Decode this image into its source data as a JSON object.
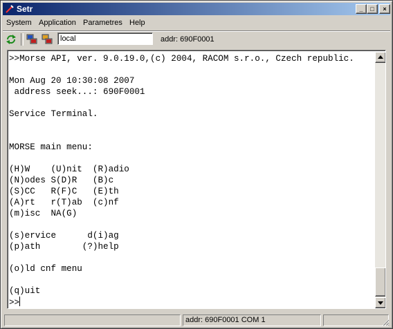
{
  "window": {
    "title": "Setr",
    "controls": [
      "_",
      "□",
      "×"
    ]
  },
  "menu": [
    "System",
    "Application",
    "Parametres",
    "Help"
  ],
  "toolbar": {
    "icons": [
      "refresh-icon",
      "connect-icon",
      "disconnect-icon"
    ],
    "combo_value": "local",
    "addr_label": "addr: 690F0001"
  },
  "terminal": {
    "lines": [
      ">>Morse API, ver. 9.0.19.0,(c) 2004, RACOM s.r.o., Czech republic.",
      "",
      "Mon Aug 20 10:30:08 2007",
      " address seek...: 690F0001",
      "",
      "Service Terminal.",
      "",
      "",
      "MORSE main menu:",
      "",
      "(H)W    (U)nit  (R)adio",
      "(N)odes S(D)R   (B)c",
      "(S)CC   R(F)C   (E)th",
      "(A)rt   r(T)ab  (c)nf",
      "(m)isc  NA(G)",
      "",
      "(s)ervice      d(i)ag",
      "(p)ath        (?)help",
      "",
      "(o)ld cnf menu",
      "",
      "(q)uit",
      ">>"
    ]
  },
  "statusbar": {
    "panes": [
      "",
      "addr: 690F0001  COM 1",
      ""
    ]
  }
}
